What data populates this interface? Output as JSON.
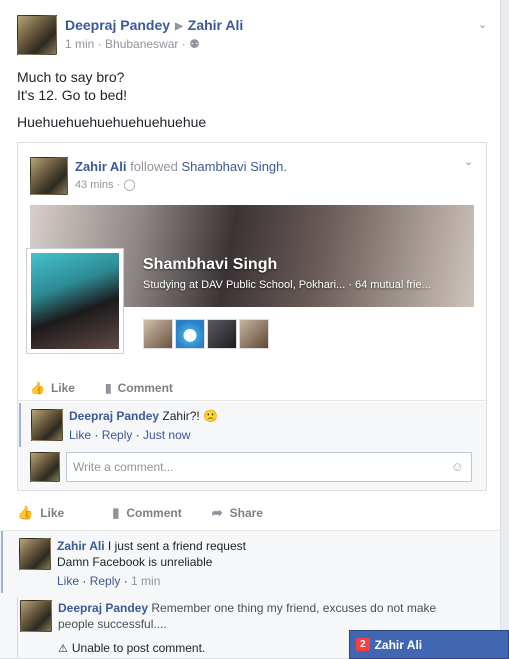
{
  "post": {
    "author": "Deepraj Pandey",
    "target": "Zahir Ali",
    "time": "1 min",
    "location": "Bhubaneswar",
    "lines": [
      "Much to say bro?",
      "It's 12. Go to bed!",
      "Huehuehuehuehuehuehuehue"
    ]
  },
  "shared": {
    "name": "Zahir Ali",
    "verb": "followed",
    "target": "Shambhavi Singh.",
    "time": "43 mins",
    "profile_name": "Shambhavi Singh",
    "profile_sub": "Studying at DAV Public School, Pokhari... · 64 mutual frie...",
    "like_label": "Like",
    "comment_label": "Comment",
    "comment": {
      "author": "Deepraj Pandey",
      "text": "Zahir?! 🙁",
      "like": "Like",
      "reply": "Reply",
      "time": "Just now"
    },
    "write_placeholder": "Write a comment..."
  },
  "actions": {
    "like": "Like",
    "comment": "Comment",
    "share": "Share"
  },
  "comments": [
    {
      "author": "Zahir Ali",
      "text1": "I just sent a friend request",
      "text2": "Damn Facebook is unreliable",
      "like": "Like",
      "reply": "Reply",
      "time": "1 min"
    },
    {
      "author": "Deepraj Pandey",
      "text": "Remember one thing my friend, excuses do not make people successful....",
      "warning": "Unable to post comment."
    }
  ],
  "chat": {
    "badge": "2",
    "name": "Zahir Ali"
  },
  "colors": {
    "link": "#3b5998",
    "chat_bar": "#4267b2",
    "badge": "#fa3e3e"
  },
  "icons": [
    "chevron-down-icon",
    "globe-icon",
    "friends-icon",
    "like-icon",
    "comment-icon",
    "share-icon",
    "smiley-icon",
    "warning-icon"
  ]
}
